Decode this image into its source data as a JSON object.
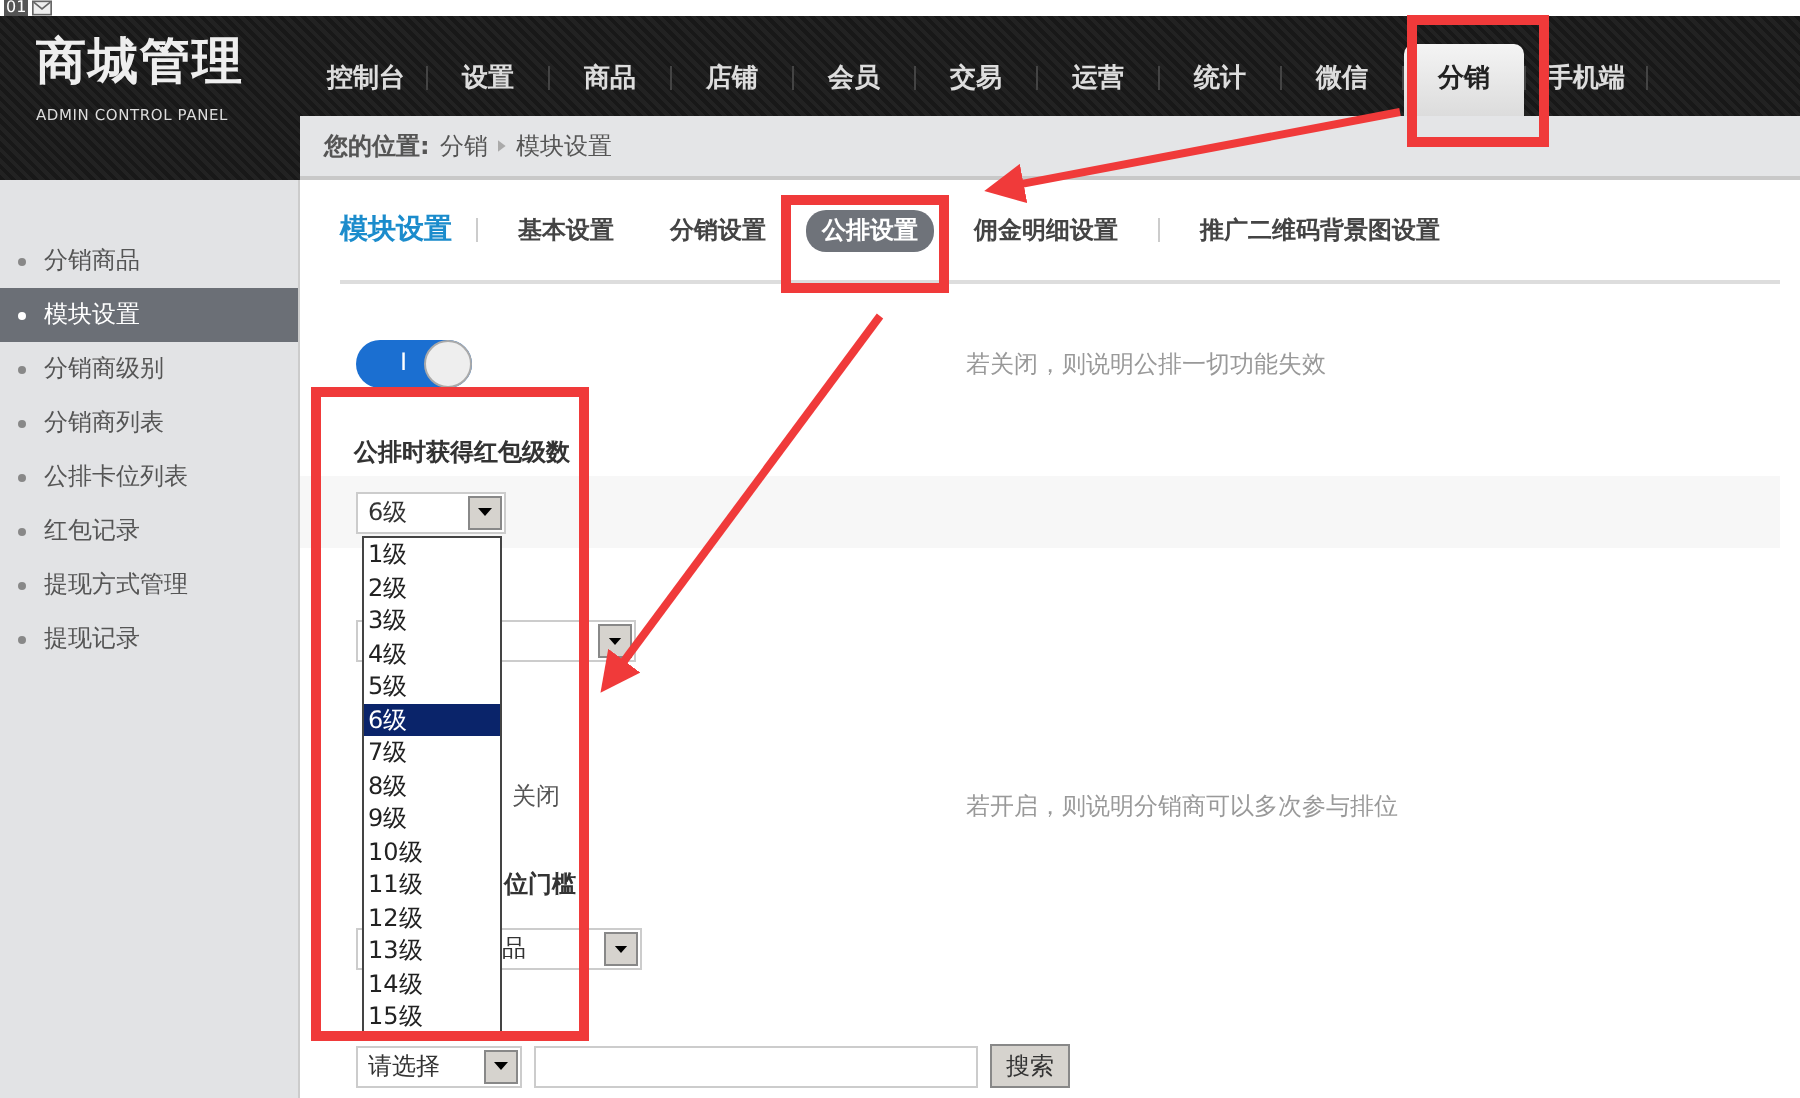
{
  "tab_strip": {
    "label": "01"
  },
  "logo": {
    "title": "商城管理",
    "subtitle": "ADMIN CONTROL PANEL"
  },
  "nav": [
    {
      "label": "控制台",
      "selected": false
    },
    {
      "label": "设置",
      "selected": false
    },
    {
      "label": "商品",
      "selected": false
    },
    {
      "label": "店铺",
      "selected": false
    },
    {
      "label": "会员",
      "selected": false
    },
    {
      "label": "交易",
      "selected": false
    },
    {
      "label": "运营",
      "selected": false
    },
    {
      "label": "统计",
      "selected": false
    },
    {
      "label": "微信",
      "selected": false
    },
    {
      "label": "分销",
      "selected": true
    },
    {
      "label": "手机端",
      "selected": false
    }
  ],
  "breadcrumb": {
    "prefix": "您的位置:",
    "items": [
      "分销",
      "模块设置"
    ]
  },
  "sidebar": [
    {
      "label": "分销商品",
      "selected": false
    },
    {
      "label": "模块设置",
      "selected": true
    },
    {
      "label": "分销商级别",
      "selected": false
    },
    {
      "label": "分销商列表",
      "selected": false
    },
    {
      "label": "公排卡位列表",
      "selected": false
    },
    {
      "label": "红包记录",
      "selected": false
    },
    {
      "label": "提现方式管理",
      "selected": false
    },
    {
      "label": "提现记录",
      "selected": false
    }
  ],
  "subtabs": {
    "title": "模块设置",
    "items": [
      {
        "label": "基本设置",
        "selected": false
      },
      {
        "label": "分销设置",
        "selected": false
      },
      {
        "label": "公排设置",
        "selected": true
      },
      {
        "label": "佣金明细设置",
        "selected": false
      },
      {
        "label": "推广二维码背景图设置",
        "selected": false
      }
    ]
  },
  "toggle": {
    "on": true,
    "label": "I",
    "hint": "若关闭，则说明公排一切功能失效"
  },
  "level_field": {
    "label": "公排时获得红包级数",
    "value": "6级",
    "options": [
      {
        "label": "1级",
        "selected": false
      },
      {
        "label": "2级",
        "selected": false
      },
      {
        "label": "3级",
        "selected": false
      },
      {
        "label": "4级",
        "selected": false
      },
      {
        "label": "5级",
        "selected": false
      },
      {
        "label": "6级",
        "selected": true
      },
      {
        "label": "7级",
        "selected": false
      },
      {
        "label": "8级",
        "selected": false
      },
      {
        "label": "9级",
        "selected": false
      },
      {
        "label": "10级",
        "selected": false
      },
      {
        "label": "11级",
        "selected": false
      },
      {
        "label": "12级",
        "selected": false
      },
      {
        "label": "13级",
        "selected": false
      },
      {
        "label": "14级",
        "selected": false
      },
      {
        "label": "15级",
        "selected": false
      }
    ]
  },
  "row_3": {
    "option": "关闭",
    "hint": "若开启，则说明分销商可以多次参与排位"
  },
  "row_4": {
    "label_end": "位门槛",
    "select_text": "品"
  },
  "search_row": {
    "select_value": "请选择",
    "button": "搜索"
  }
}
